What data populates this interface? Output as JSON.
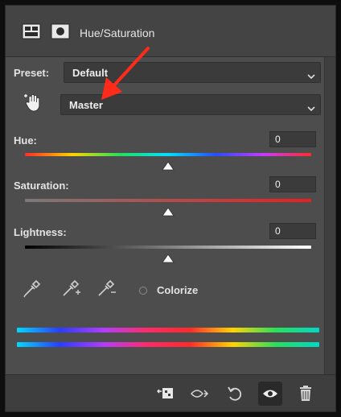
{
  "header": {
    "title": "Hue/Saturation",
    "icons": [
      "adjustment-layer-icon",
      "layer-mask-icon"
    ]
  },
  "preset": {
    "label": "Preset:",
    "value": "Default"
  },
  "channel": {
    "value": "Master",
    "icon": "targeted-adjustment-hand-icon"
  },
  "hue": {
    "label": "Hue:",
    "value": "0",
    "slider_position": 0.5
  },
  "saturation": {
    "label": "Saturation:",
    "value": "0",
    "slider_position": 0.5
  },
  "lightness": {
    "label": "Lightness:",
    "value": "0",
    "slider_position": 0.5
  },
  "tools": {
    "eyedroppers": [
      "eyedropper-icon",
      "eyedropper-plus-icon",
      "eyedropper-minus-icon"
    ],
    "colorize_label": "Colorize",
    "colorize_checked": false
  },
  "footer": {
    "icons": [
      "clip-to-layer-icon",
      "view-previous-state-icon",
      "reset-icon",
      "visibility-eye-icon",
      "trash-icon"
    ]
  },
  "colors": {
    "panel_bg": "#4d4d4d",
    "annotation_arrow": "#ff2b1a"
  }
}
